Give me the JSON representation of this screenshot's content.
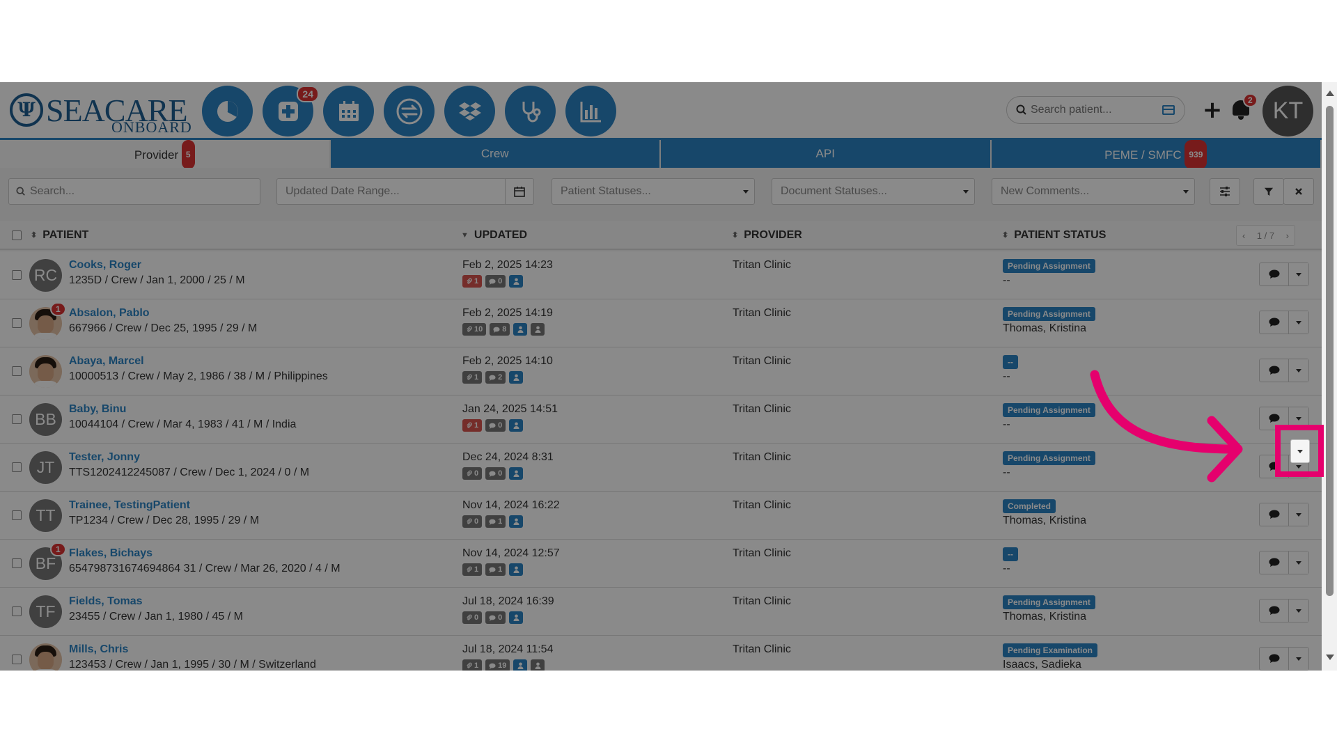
{
  "brand": {
    "line1": "SEACARE",
    "line2": "ONBOARD",
    "mark": "Ψ"
  },
  "nav_badges": {
    "add_patient": "24"
  },
  "search": {
    "placeholder": "Search patient..."
  },
  "header": {
    "plus": "+",
    "notifications": "2",
    "user_initials": "KT"
  },
  "tabs": [
    {
      "label": "Provider",
      "badge": "5"
    },
    {
      "label": "Crew"
    },
    {
      "label": "API"
    },
    {
      "label": "PEME / SMFC",
      "badge": "939"
    }
  ],
  "filters": {
    "search_placeholder": "Search...",
    "date_range_placeholder": "Updated Date Range...",
    "patient_statuses": "Patient Statuses...",
    "document_statuses": "Document Statuses...",
    "new_comments": "New Comments..."
  },
  "columns": {
    "patient": "PATIENT",
    "updated": "UPDATED",
    "provider": "PROVIDER",
    "status": "PATIENT STATUS"
  },
  "pager": {
    "prev": "‹",
    "label": "1 / 7",
    "next": "›"
  },
  "rows": [
    {
      "initials": "RC",
      "photo": false,
      "badge": "",
      "name": "Cooks, Roger",
      "details": "1235D / Crew / Jan 1, 2000 / 25 / M",
      "updated": "Feb 2, 2025 14:23",
      "chips": [
        {
          "t": "1",
          "c": "red",
          "i": "clip"
        },
        {
          "t": "0",
          "c": "gray",
          "i": "msg"
        },
        {
          "t": "",
          "c": "blue",
          "i": "user"
        }
      ],
      "provider": "Tritan Clinic",
      "status": "Pending Assignment",
      "assignee": "--"
    },
    {
      "initials": "",
      "photo": true,
      "badge": "1",
      "name": "Absalon, Pablo",
      "details": "667966 / Crew / Dec 25, 1995 / 29 / M",
      "updated": "Feb 2, 2025 14:19",
      "chips": [
        {
          "t": "10",
          "c": "gray",
          "i": "clip"
        },
        {
          "t": "8",
          "c": "gray",
          "i": "msg"
        },
        {
          "t": "",
          "c": "blue",
          "i": "user"
        },
        {
          "t": "",
          "c": "gray2",
          "i": "user"
        }
      ],
      "provider": "Tritan Clinic",
      "status": "Pending Assignment",
      "assignee": "Thomas, Kristina"
    },
    {
      "initials": "",
      "photo": true,
      "badge": "",
      "name": "Abaya, Marcel",
      "details": "10000513 / Crew / May 2, 1986 / 38 / M / Philippines",
      "updated": "Feb 2, 2025 14:10",
      "chips": [
        {
          "t": "1",
          "c": "gray",
          "i": "clip"
        },
        {
          "t": "2",
          "c": "gray",
          "i": "msg"
        },
        {
          "t": "",
          "c": "blue",
          "i": "user"
        }
      ],
      "provider": "Tritan Clinic",
      "status": "--",
      "assignee": "--"
    },
    {
      "initials": "BB",
      "photo": false,
      "badge": "",
      "name": "Baby, Binu",
      "details": "10044104 / Crew / Mar 4, 1983 / 41 / M / India",
      "updated": "Jan 24, 2025 14:51",
      "chips": [
        {
          "t": "1",
          "c": "red",
          "i": "clip"
        },
        {
          "t": "0",
          "c": "gray",
          "i": "msg"
        },
        {
          "t": "",
          "c": "blue",
          "i": "user"
        }
      ],
      "provider": "Tritan Clinic",
      "status": "Pending Assignment",
      "assignee": "--"
    },
    {
      "initials": "JT",
      "photo": false,
      "badge": "",
      "name": "Tester, Jonny",
      "details": "TTS1202412245087 / Crew / Dec 1, 2024 / 0 / M",
      "updated": "Dec 24, 2024 8:31",
      "chips": [
        {
          "t": "0",
          "c": "gray",
          "i": "clip"
        },
        {
          "t": "0",
          "c": "gray",
          "i": "msg"
        },
        {
          "t": "",
          "c": "blue",
          "i": "user"
        }
      ],
      "provider": "Tritan Clinic",
      "status": "Pending Assignment",
      "assignee": "--"
    },
    {
      "initials": "TT",
      "photo": false,
      "badge": "",
      "name": "Trainee, TestingPatient",
      "details": "TP1234 / Crew / Dec 28, 1995 / 29 / M",
      "updated": "Nov 14, 2024 16:22",
      "chips": [
        {
          "t": "0",
          "c": "gray",
          "i": "clip"
        },
        {
          "t": "1",
          "c": "gray",
          "i": "msg"
        },
        {
          "t": "",
          "c": "blue",
          "i": "user"
        }
      ],
      "provider": "Tritan Clinic",
      "status": "Completed",
      "assignee": "Thomas, Kristina"
    },
    {
      "initials": "BF",
      "photo": false,
      "badge": "1",
      "name": "Flakes, Bichays",
      "details": "654798731674694864 31 / Crew / Mar 26, 2020 / 4 / M",
      "updated": "Nov 14, 2024 12:57",
      "chips": [
        {
          "t": "1",
          "c": "gray",
          "i": "clip"
        },
        {
          "t": "1",
          "c": "gray",
          "i": "msg"
        },
        {
          "t": "",
          "c": "blue",
          "i": "user"
        }
      ],
      "provider": "Tritan Clinic",
      "status": "--",
      "assignee": "--"
    },
    {
      "initials": "TF",
      "photo": false,
      "badge": "",
      "name": "Fields, Tomas",
      "details": "23455 / Crew / Jan 1, 1980 / 45 / M",
      "updated": "Jul 18, 2024 16:39",
      "chips": [
        {
          "t": "0",
          "c": "gray",
          "i": "clip"
        },
        {
          "t": "0",
          "c": "gray",
          "i": "msg"
        },
        {
          "t": "",
          "c": "blue",
          "i": "user"
        }
      ],
      "provider": "Tritan Clinic",
      "status": "Pending Assignment",
      "assignee": "Thomas, Kristina"
    },
    {
      "initials": "",
      "photo": true,
      "badge": "",
      "name": "Mills, Chris",
      "details": "123453 / Crew / Jan 1, 1995 / 30 / M / Switzerland",
      "updated": "Jul 18, 2024 11:54",
      "chips": [
        {
          "t": "1",
          "c": "gray",
          "i": "clip"
        },
        {
          "t": "19",
          "c": "gray",
          "i": "msg"
        },
        {
          "t": "",
          "c": "blue",
          "i": "user"
        },
        {
          "t": "",
          "c": "gray2",
          "i": "user"
        }
      ],
      "provider": "Tritan Clinic",
      "status": "Pending Examination",
      "assignee": "Isaacs, Sadieka"
    }
  ],
  "colors": {
    "accent": "#2c84c4",
    "highlight": "#e5006d",
    "badge": "#dd3333"
  }
}
